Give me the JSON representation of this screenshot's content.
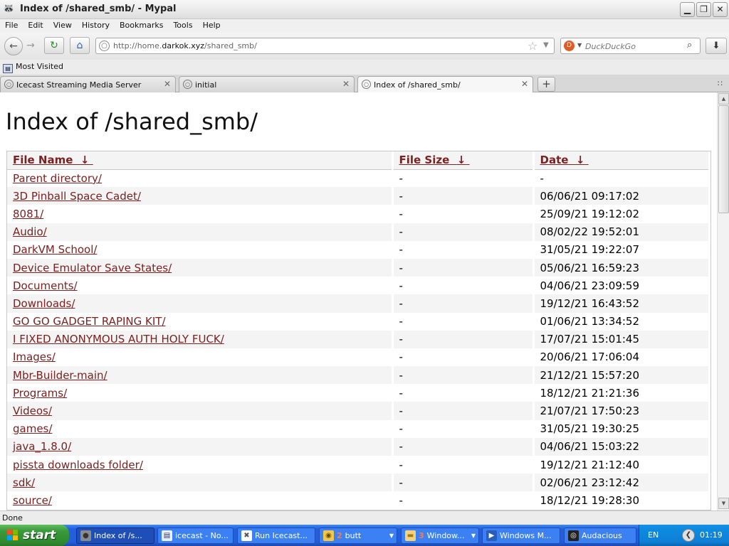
{
  "window": {
    "title": "Index of /shared_smb/ - Mypal",
    "app_icon": "mypal-raccoon-icon"
  },
  "menu": [
    "File",
    "Edit",
    "View",
    "History",
    "Bookmarks",
    "Tools",
    "Help"
  ],
  "navbar": {
    "url_prefix": "http://home.",
    "url_domain": "darkok.xyz",
    "url_path": "/shared_smb/",
    "search_placeholder": "DuckDuckGo"
  },
  "bookmarks": {
    "most_visited": "Most Visited"
  },
  "tabs": [
    {
      "label": "Icecast Streaming Media Server",
      "active": false
    },
    {
      "label": "initial",
      "active": false
    },
    {
      "label": "Index of /shared_smb/",
      "active": true
    }
  ],
  "page": {
    "heading": "Index of /shared_smb/",
    "columns": {
      "name": "File Name",
      "size": "File Size",
      "date": "Date",
      "sort_arrow": "↓"
    },
    "rows": [
      {
        "name": "Parent directory/",
        "size": "-",
        "date": "-"
      },
      {
        "name": "3D Pinball Space Cadet/",
        "size": "-",
        "date": "06/06/21 09:17:02"
      },
      {
        "name": "8081/",
        "size": "-",
        "date": "25/09/21 19:12:02"
      },
      {
        "name": "Audio/",
        "size": "-",
        "date": "08/02/22 19:52:01"
      },
      {
        "name": "DarkVM School/",
        "size": "-",
        "date": "31/05/21 19:22:07"
      },
      {
        "name": "Device Emulator Save States/",
        "size": "-",
        "date": "05/06/21 16:59:23"
      },
      {
        "name": "Documents/",
        "size": "-",
        "date": "04/06/21 23:09:59"
      },
      {
        "name": "Downloads/",
        "size": "-",
        "date": "19/12/21 16:43:52"
      },
      {
        "name": "GO GO GADGET RAPING KIT/",
        "size": "-",
        "date": "01/06/21 13:34:52"
      },
      {
        "name": "I FIXED ANONYMOUS AUTH HOLY FUCK/",
        "size": "-",
        "date": "17/07/21 15:01:45"
      },
      {
        "name": "Images/",
        "size": "-",
        "date": "20/06/21 17:06:04"
      },
      {
        "name": "Mbr-Builder-main/",
        "size": "-",
        "date": "21/12/21 15:57:20"
      },
      {
        "name": "Programs/",
        "size": "-",
        "date": "18/12/21 21:21:36"
      },
      {
        "name": "Videos/",
        "size": "-",
        "date": "21/07/21 17:50:23"
      },
      {
        "name": "games/",
        "size": "-",
        "date": "31/05/21 19:30:25"
      },
      {
        "name": "java_1.8.0/",
        "size": "-",
        "date": "04/06/21 15:03:22"
      },
      {
        "name": "pissta downloads folder/",
        "size": "-",
        "date": "19/12/21 21:12:40"
      },
      {
        "name": "sdk/",
        "size": "-",
        "date": "02/06/21 23:12:42"
      },
      {
        "name": "source/",
        "size": "-",
        "date": "18/12/21 19:28:30"
      }
    ]
  },
  "status": "Done",
  "taskbar": {
    "start_label": "start",
    "items": [
      {
        "label": "Index of /s...",
        "icon": "mypal-icon",
        "count": "",
        "active": true,
        "dropdown": false
      },
      {
        "label": "icecast - No...",
        "icon": "notepad-icon",
        "count": "",
        "active": false,
        "dropdown": false
      },
      {
        "label": "Run Icecast...",
        "icon": "run-icon",
        "count": "",
        "active": false,
        "dropdown": false
      },
      {
        "label": "butt",
        "icon": "butt-icon",
        "count": "2",
        "active": false,
        "dropdown": true
      },
      {
        "label": "Window...",
        "icon": "folder-icon",
        "count": "3",
        "active": false,
        "dropdown": true
      },
      {
        "label": "Windows M...",
        "icon": "media-player-icon",
        "count": "",
        "active": false,
        "dropdown": false
      },
      {
        "label": "Audacious",
        "icon": "audacious-icon",
        "count": "",
        "active": false,
        "dropdown": false
      }
    ],
    "language": "EN",
    "clock": "01:19"
  }
}
